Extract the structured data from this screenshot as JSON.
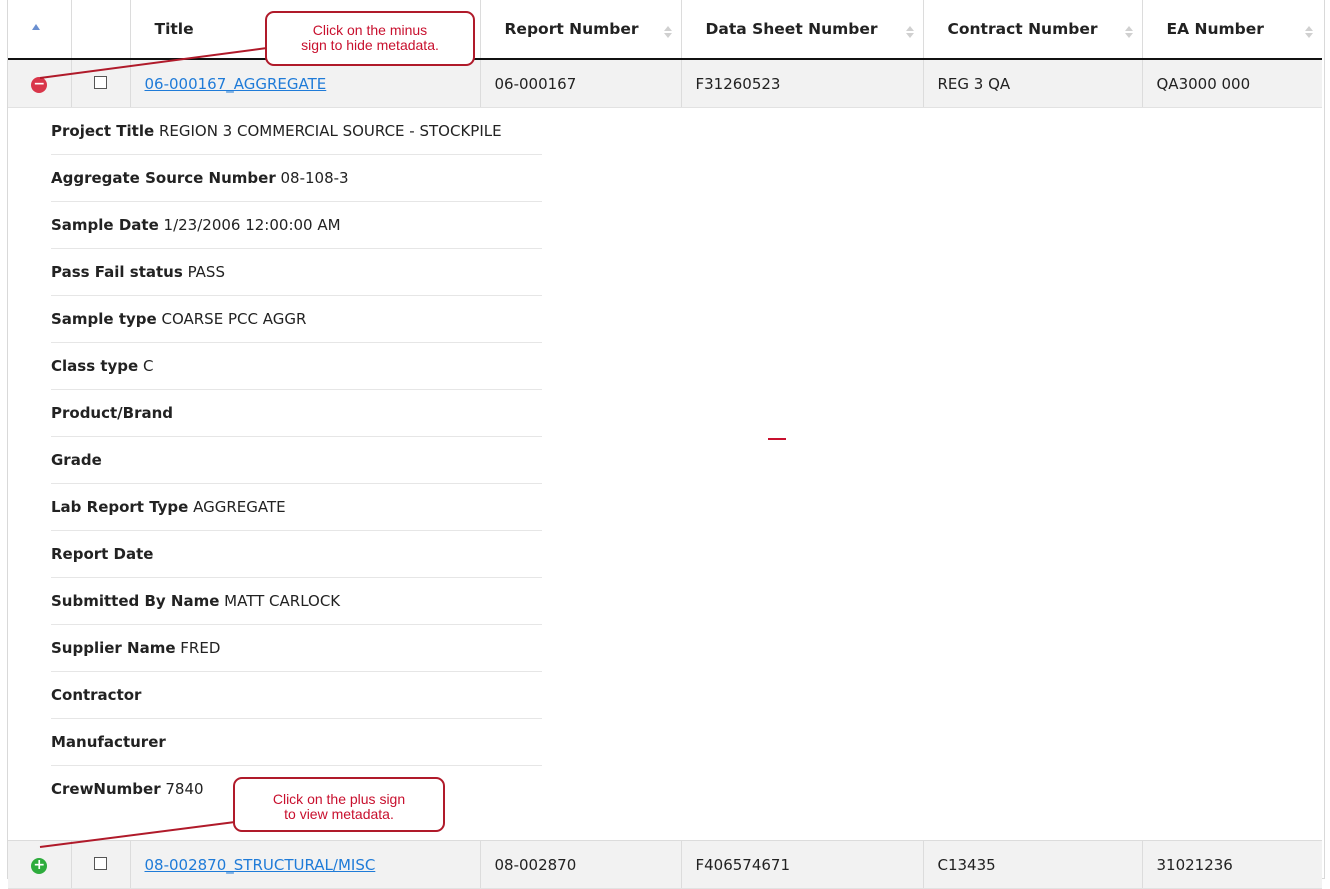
{
  "columns": {
    "title": "Title",
    "report_number": "Report Number",
    "data_sheet_number": "Data Sheet Number",
    "contract_number": "Contract Number",
    "ea_number": "EA Number"
  },
  "rows": [
    {
      "toggle_icon": "minus-circle-icon",
      "title_link": "06-000167_AGGREGATE",
      "report_number": "06-000167",
      "data_sheet_number": "F31260523",
      "contract_number": "REG 3 QA",
      "ea_number": "QA3000 000"
    },
    {
      "toggle_icon": "plus-circle-icon",
      "title_link": "08-002870_STRUCTURAL/MISC",
      "report_number": "08-002870",
      "data_sheet_number": "F406574671",
      "contract_number": "C13435",
      "ea_number": "31021236"
    }
  ],
  "metadata": [
    {
      "label": "Project Title",
      "value": "REGION 3 COMMERCIAL SOURCE - STOCKPILE"
    },
    {
      "label": "Aggregate Source Number",
      "value": "08-108-3"
    },
    {
      "label": "Sample Date",
      "value": "1/23/2006 12:00:00 AM"
    },
    {
      "label": "Pass Fail status",
      "value": "PASS"
    },
    {
      "label": "Sample type",
      "value": "COARSE PCC AGGR"
    },
    {
      "label": "Class type",
      "value": " C"
    },
    {
      "label": "Product/Brand",
      "value": ""
    },
    {
      "label": "Grade",
      "value": ""
    },
    {
      "label": "Lab Report Type",
      "value": "AGGREGATE"
    },
    {
      "label": "Report Date",
      "value": ""
    },
    {
      "label": "Submitted By Name",
      "value": "MATT CARLOCK"
    },
    {
      "label": "Supplier Name",
      "value": "FRED"
    },
    {
      "label": "Contractor",
      "value": ""
    },
    {
      "label": "Manufacturer",
      "value": ""
    },
    {
      "label": "CrewNumber",
      "value": "7840"
    }
  ],
  "callouts": {
    "minus_line1": "Click on the minus",
    "minus_line2": "sign to hide metadata.",
    "plus_line1": "Click on the plus sign",
    "plus_line2": "to view metadata."
  },
  "colors": {
    "link": "#1f7bd8",
    "minus": "#d9364a",
    "plus": "#2eac3d",
    "callout": "#b01a2a"
  }
}
